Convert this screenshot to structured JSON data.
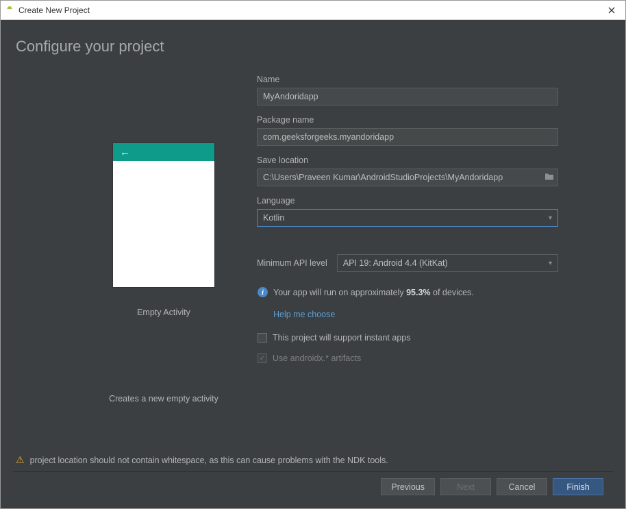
{
  "window": {
    "title": "Create New Project"
  },
  "heading": "Configure your project",
  "preview": {
    "caption": "Empty Activity",
    "subcaption": "Creates a new empty activity"
  },
  "form": {
    "name": {
      "label": "Name",
      "value": "MyAndoridapp"
    },
    "package": {
      "label": "Package name",
      "value": "com.geeksforgeeks.myandoridapp"
    },
    "save": {
      "label": "Save location",
      "value": "C:\\Users\\Praveen Kumar\\AndroidStudioProjects\\MyAndoridapp"
    },
    "language": {
      "label": "Language",
      "value": "Kotlin"
    },
    "api": {
      "label": "Minimum API level",
      "value": "API 19: Android 4.4 (KitKat)"
    },
    "coverage": {
      "prefix": "Your app will run on approximately ",
      "percent": "95.3%",
      "suffix": " of devices."
    },
    "help": "Help me choose",
    "instantAppsLabel": "This project will support instant apps",
    "androidxLabel": "Use androidx.* artifacts"
  },
  "warning": "project location should not contain whitespace, as this can cause problems with the NDK tools.",
  "buttons": {
    "previous": "Previous",
    "next": "Next",
    "cancel": "Cancel",
    "finish": "Finish"
  }
}
